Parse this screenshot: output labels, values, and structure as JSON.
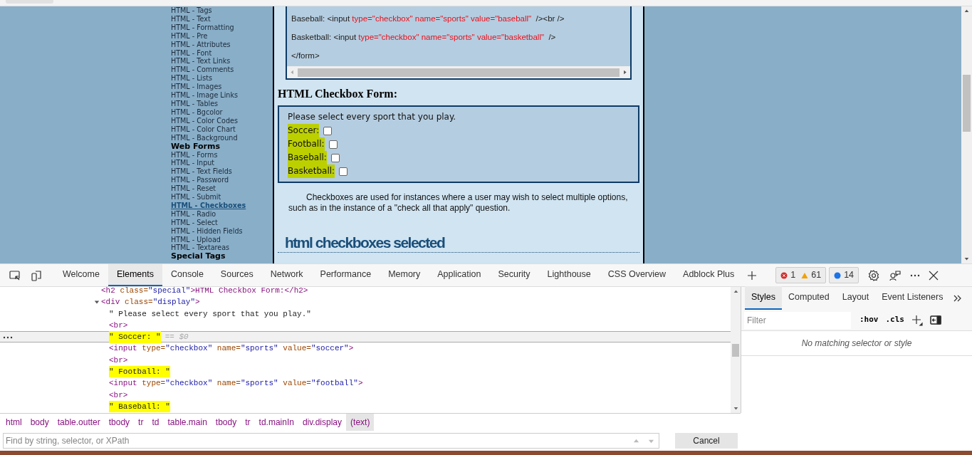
{
  "sidebar": {
    "items": [
      {
        "label": "HTML - Tags",
        "kind": "link",
        "selected": false
      },
      {
        "label": "HTML - Text",
        "kind": "link",
        "selected": false
      },
      {
        "label": "HTML - Formatting",
        "kind": "link",
        "selected": false
      },
      {
        "label": "HTML - Pre",
        "kind": "link",
        "selected": false
      },
      {
        "label": "HTML - Attributes",
        "kind": "link",
        "selected": false
      },
      {
        "label": "HTML - Font",
        "kind": "link",
        "selected": false
      },
      {
        "label": "HTML - Text Links",
        "kind": "link",
        "selected": false
      },
      {
        "label": "HTML - Comments",
        "kind": "link",
        "selected": false
      },
      {
        "label": "HTML - Lists",
        "kind": "link",
        "selected": false
      },
      {
        "label": "HTML - Images",
        "kind": "link",
        "selected": false
      },
      {
        "label": "HTML - Image Links",
        "kind": "link",
        "selected": false
      },
      {
        "label": "HTML - Tables",
        "kind": "link",
        "selected": false
      },
      {
        "label": "HTML - Bgcolor",
        "kind": "link",
        "selected": false
      },
      {
        "label": "HTML - Color Codes",
        "kind": "link",
        "selected": false
      },
      {
        "label": "HTML - Color Chart",
        "kind": "link",
        "selected": false
      },
      {
        "label": "HTML - Background",
        "kind": "link",
        "selected": false
      },
      {
        "label": "Web Forms",
        "kind": "heading"
      },
      {
        "label": "HTML - Forms",
        "kind": "link",
        "selected": false
      },
      {
        "label": "HTML - Input",
        "kind": "link",
        "selected": false
      },
      {
        "label": "HTML - Text Fields",
        "kind": "link",
        "selected": false
      },
      {
        "label": "HTML - Password",
        "kind": "link",
        "selected": false
      },
      {
        "label": "HTML - Reset",
        "kind": "link",
        "selected": false
      },
      {
        "label": "HTML - Submit",
        "kind": "link",
        "selected": false
      },
      {
        "label": "HTML - Checkboxes",
        "kind": "link",
        "selected": true
      },
      {
        "label": "HTML - Radio",
        "kind": "link",
        "selected": false
      },
      {
        "label": "HTML - Select",
        "kind": "link",
        "selected": false
      },
      {
        "label": "HTML - Hidden Fields",
        "kind": "link",
        "selected": false
      },
      {
        "label": "HTML - Upload",
        "kind": "link",
        "selected": false
      },
      {
        "label": "HTML - Textareas",
        "kind": "link",
        "selected": false
      },
      {
        "label": "Special Tags",
        "kind": "heading"
      }
    ]
  },
  "code_sample": {
    "lines": [
      "Baseball: <input type=\"checkbox\" name=\"sports\" value=\"baseball\"  /><br />",
      "Basketball: <input type=\"checkbox\" name=\"sports\" value=\"basketball\"  />",
      "</form>"
    ]
  },
  "form_section": {
    "heading": "HTML Checkbox Form:",
    "prompt": "Please select every sport that you play.",
    "options": [
      {
        "label": "Soccer:",
        "checked": false,
        "highlighted": true
      },
      {
        "label": "Football:",
        "checked": false,
        "highlighted": true
      },
      {
        "label": "Baseball:",
        "checked": false,
        "highlighted": true
      },
      {
        "label": "Basketball:",
        "checked": false,
        "highlighted": true
      }
    ]
  },
  "paragraph": "Checkboxes are used for instances where a user may wish to select multiple options, such as in the instance of a \"check all that apply\" question.",
  "next_heading": "html checkboxes selected",
  "devtools": {
    "tabs": [
      {
        "label": "Welcome",
        "selected": false
      },
      {
        "label": "Elements",
        "selected": true
      },
      {
        "label": "Console",
        "selected": false
      },
      {
        "label": "Sources",
        "selected": false
      },
      {
        "label": "Network",
        "selected": false
      },
      {
        "label": "Performance",
        "selected": false
      },
      {
        "label": "Memory",
        "selected": false
      },
      {
        "label": "Application",
        "selected": false
      },
      {
        "label": "Security",
        "selected": false
      },
      {
        "label": "Lighthouse",
        "selected": false
      },
      {
        "label": "CSS Overview",
        "selected": false
      },
      {
        "label": "Adblock Plus",
        "selected": false
      }
    ],
    "errors": "1",
    "warnings": "61",
    "messages": "14",
    "dom": [
      {
        "kind": "element",
        "markup": "<h2 class=\"special\">HTML Checkbox Form:</h2>"
      },
      {
        "kind": "element",
        "markup": "<div class=\"display\">",
        "expanded": true,
        "children": [
          {
            "kind": "text",
            "markup": "\" Please select every sport that you play.\"",
            "highlighted": false,
            "selected": false
          },
          {
            "kind": "element",
            "markup": "<br>"
          },
          {
            "kind": "text",
            "markup": "\" Soccer: \"",
            "highlighted": true,
            "selected": true,
            "ref": "== $0"
          },
          {
            "kind": "element",
            "markup": "<input type=\"checkbox\" name=\"sports\" value=\"soccer\">"
          },
          {
            "kind": "element",
            "markup": "<br>"
          },
          {
            "kind": "text",
            "markup": "\" Football: \"",
            "highlighted": true,
            "selected": false
          },
          {
            "kind": "element",
            "markup": "<input type=\"checkbox\" name=\"sports\" value=\"football\">"
          },
          {
            "kind": "element",
            "markup": "<br>"
          },
          {
            "kind": "text",
            "markup": "\" Baseball: \"",
            "highlighted": true,
            "selected": false
          }
        ]
      }
    ],
    "breadcrumbs": [
      {
        "label": "html",
        "selected": false
      },
      {
        "label": "body",
        "selected": false
      },
      {
        "label": "table.outter",
        "selected": false
      },
      {
        "label": "tbody",
        "selected": false
      },
      {
        "label": "tr",
        "selected": false
      },
      {
        "label": "td",
        "selected": false
      },
      {
        "label": "table.main",
        "selected": false
      },
      {
        "label": "tbody",
        "selected": false
      },
      {
        "label": "tr",
        "selected": false
      },
      {
        "label": "td.mainIn",
        "selected": false
      },
      {
        "label": "div.display",
        "selected": false
      },
      {
        "label": "(text)",
        "selected": true
      }
    ],
    "search": {
      "placeholder": "Find by string, selector, or XPath"
    },
    "cancel": "Cancel",
    "side_tabs": [
      {
        "label": "Styles",
        "selected": true
      },
      {
        "label": "Computed",
        "selected": false
      },
      {
        "label": "Layout",
        "selected": false
      },
      {
        "label": "Event Listeners",
        "selected": false
      }
    ],
    "filter": {
      "placeholder": "Filter"
    },
    "hov": ":hov",
    "cls": ".cls",
    "empty_note": "No matching selector or style"
  }
}
